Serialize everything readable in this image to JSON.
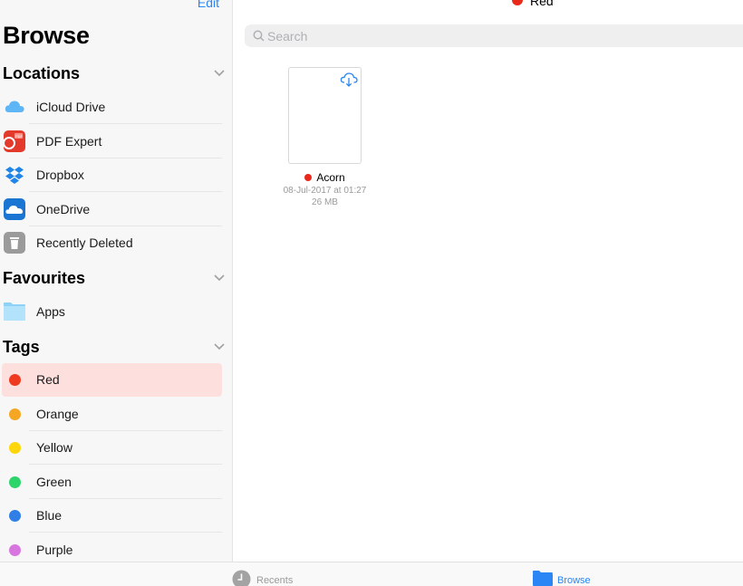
{
  "sidebar": {
    "edit_label": "Edit",
    "title": "Browse",
    "sections": {
      "locations": "Locations",
      "favourites": "Favourites",
      "tags": "Tags"
    },
    "locations": [
      {
        "label": "iCloud Drive",
        "icon": "icloud-icon"
      },
      {
        "label": "PDF Expert",
        "icon": "pdf-expert-icon"
      },
      {
        "label": "Dropbox",
        "icon": "dropbox-icon"
      },
      {
        "label": "OneDrive",
        "icon": "onedrive-icon"
      },
      {
        "label": "Recently Deleted",
        "icon": "trash-icon"
      }
    ],
    "favourites": [
      {
        "label": "Apps",
        "icon": "folder-icon"
      }
    ],
    "tags": [
      {
        "label": "Red",
        "color": "#f03a1f",
        "selected": true
      },
      {
        "label": "Orange",
        "color": "#f5a623"
      },
      {
        "label": "Yellow",
        "color": "#ffd60a"
      },
      {
        "label": "Green",
        "color": "#2dd46a"
      },
      {
        "label": "Blue",
        "color": "#2f7fe6"
      },
      {
        "label": "Purple",
        "color": "#d876e0"
      }
    ]
  },
  "main": {
    "nav_title": "Red",
    "nav_dot_color": "#e8291c",
    "search_placeholder": "Search",
    "file": {
      "name": "Acorn",
      "date": "08-Jul-2017 at 01:27",
      "size": "26 MB",
      "tag_color": "#e8291c",
      "icon": "cloud-download-icon"
    }
  },
  "tabbar": {
    "recents_label": "Recents",
    "browse_label": "Browse",
    "active_color": "#2a86f5",
    "inactive_color": "#9a9a9a"
  }
}
